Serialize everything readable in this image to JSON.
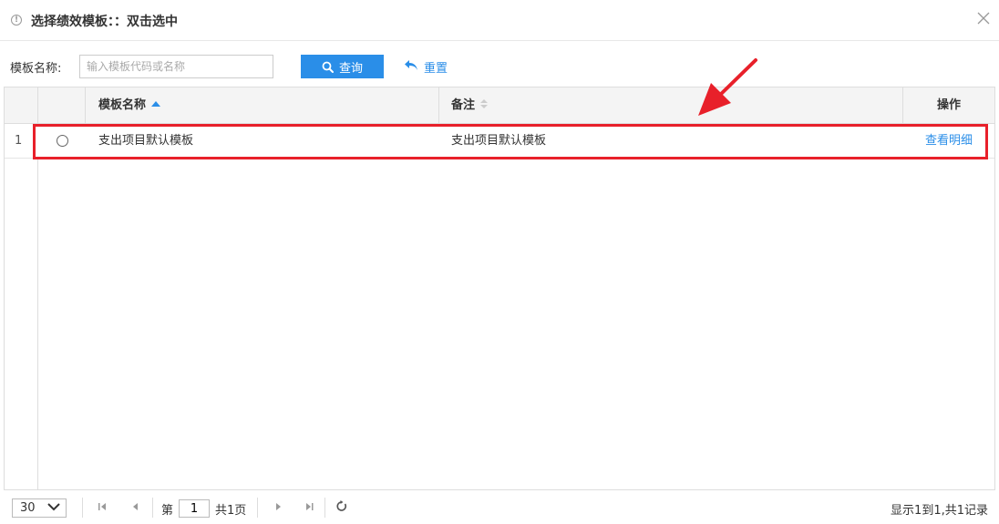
{
  "dialog": {
    "title": "选择绩效模板：：双击选中",
    "info_icon": "info-circle-icon",
    "close_icon": "close-icon"
  },
  "search": {
    "label": "模板名称:",
    "placeholder": "输入模板代码或名称",
    "value": "",
    "search_button": "查询",
    "search_icon": "search-icon",
    "reset_button": "重置",
    "reset_icon": "undo-arrow-icon"
  },
  "table": {
    "columns": [
      {
        "label": "",
        "key": "rownum"
      },
      {
        "label": "",
        "key": "select"
      },
      {
        "label": "模板名称",
        "key": "name",
        "sort": "asc"
      },
      {
        "label": "备注",
        "key": "remark",
        "sort": "none"
      },
      {
        "label": "操作",
        "key": "action"
      }
    ],
    "rows": [
      {
        "rownum": "1",
        "selected": false,
        "name": "支出项目默认模板",
        "remark": "支出项目默认模板",
        "action": "查看明细"
      }
    ]
  },
  "annotation": {
    "highlight_color": "#e8202a",
    "arrow_color": "#e8202a"
  },
  "pager": {
    "page_size": "30",
    "page_prefix": "第",
    "current_page": "1",
    "page_suffix": "共1页",
    "record_info": "显示1到1,共1记录"
  },
  "colors": {
    "accent": "#2a8ee8",
    "header_bg": "#f4f4f4",
    "border": "#dddddd"
  }
}
